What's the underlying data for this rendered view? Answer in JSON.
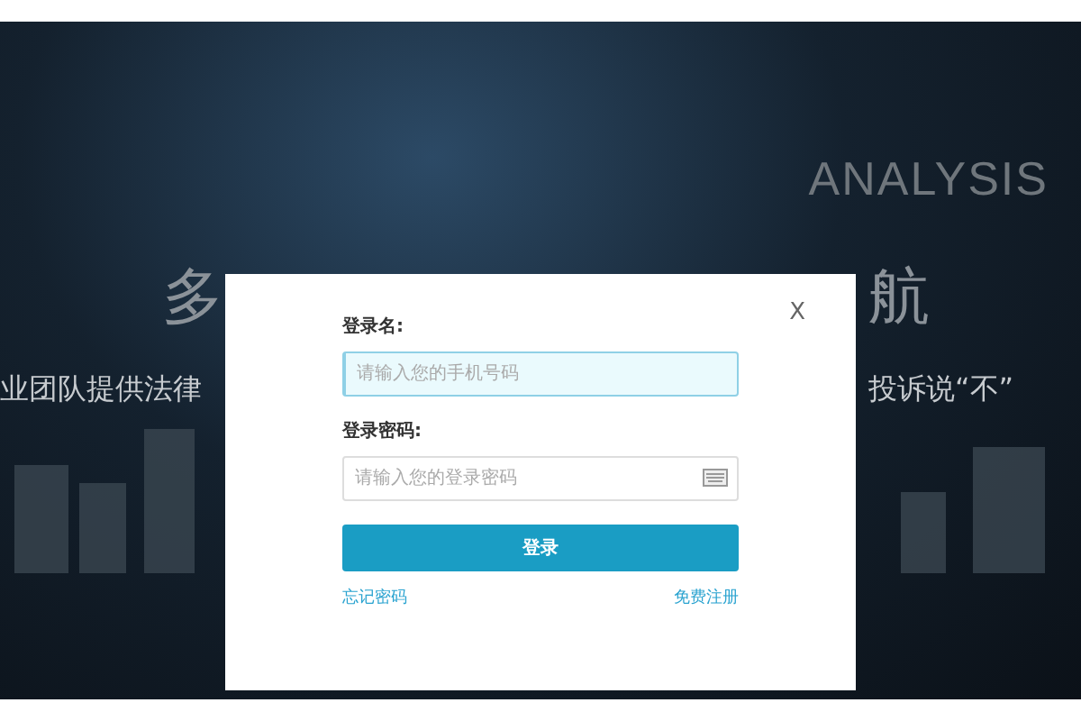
{
  "background": {
    "tagline": "ANALYSIS",
    "headline_left": "多",
    "headline_right": "航",
    "subtitle_left": "业团队提供法律",
    "subtitle_right": "投诉说“不”"
  },
  "login_dialog": {
    "close": "X",
    "fields": [
      {
        "label": "登录名:",
        "placeholder": "请输入您的手机号码",
        "focused": true,
        "kind": "text"
      },
      {
        "label": "登录密码:",
        "placeholder": "请输入您的登录密码",
        "focused": false,
        "kind": "password"
      }
    ],
    "submit": "登录",
    "forgot_link": "忘记密码",
    "register_link": "免费注册"
  }
}
